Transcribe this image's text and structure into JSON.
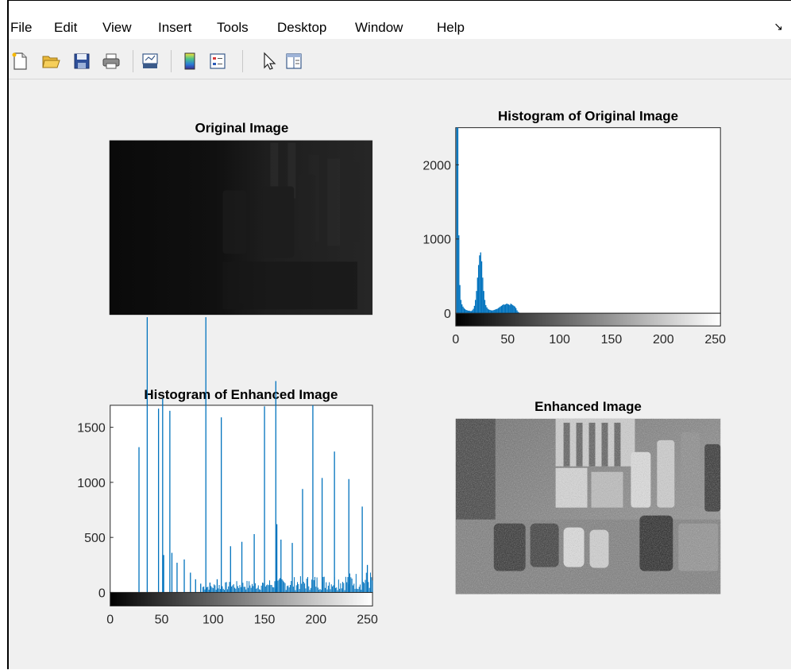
{
  "menu": {
    "items": [
      "File",
      "Edit",
      "View",
      "Insert",
      "Tools",
      "Desktop",
      "Window",
      "Help"
    ]
  },
  "toolbar": {
    "icons": [
      "new-file-icon",
      "open-folder-icon",
      "save-icon",
      "print-icon",
      "link-plot-icon",
      "colorbar-icon",
      "legend-icon",
      "pointer-icon",
      "property-inspector-icon"
    ]
  },
  "axes": {
    "original_image_title": "Original Image",
    "histogram_original_title": "Histogram of Original Image",
    "histogram_enhanced_title": "Histogram of Enhanced Image",
    "enhanced_image_title": "Enhanced Image"
  },
  "chart_data": [
    {
      "type": "bar",
      "title": "Histogram of Original Image",
      "xlim": [
        0,
        255
      ],
      "ylim": [
        0,
        2500
      ],
      "xticks": [
        0,
        50,
        100,
        150,
        200,
        250
      ],
      "yticks": [
        0,
        1000,
        2000
      ],
      "bars": [
        [
          1,
          2500
        ],
        [
          2,
          2500
        ],
        [
          3,
          1050
        ],
        [
          4,
          380
        ],
        [
          5,
          180
        ],
        [
          6,
          120
        ],
        [
          7,
          90
        ],
        [
          8,
          70
        ],
        [
          9,
          55
        ],
        [
          10,
          45
        ],
        [
          11,
          40
        ],
        [
          12,
          35
        ],
        [
          13,
          35
        ],
        [
          14,
          30
        ],
        [
          15,
          30
        ],
        [
          16,
          40
        ],
        [
          17,
          60
        ],
        [
          18,
          100
        ],
        [
          19,
          180
        ],
        [
          20,
          300
        ],
        [
          21,
          480
        ],
        [
          22,
          650
        ],
        [
          23,
          780
        ],
        [
          24,
          820
        ],
        [
          25,
          700
        ],
        [
          26,
          480
        ],
        [
          27,
          300
        ],
        [
          28,
          180
        ],
        [
          29,
          110
        ],
        [
          30,
          80
        ],
        [
          31,
          60
        ],
        [
          32,
          50
        ],
        [
          33,
          45
        ],
        [
          34,
          40
        ],
        [
          35,
          38
        ],
        [
          36,
          40
        ],
        [
          37,
          45
        ],
        [
          38,
          50
        ],
        [
          39,
          55
        ],
        [
          40,
          60
        ],
        [
          41,
          70
        ],
        [
          42,
          80
        ],
        [
          43,
          90
        ],
        [
          44,
          100
        ],
        [
          45,
          110
        ],
        [
          46,
          120
        ],
        [
          47,
          115
        ],
        [
          48,
          120
        ],
        [
          49,
          130
        ],
        [
          50,
          125
        ],
        [
          51,
          120
        ],
        [
          52,
          110
        ],
        [
          53,
          130
        ],
        [
          54,
          120
        ],
        [
          55,
          110
        ],
        [
          56,
          100
        ],
        [
          57,
          90
        ],
        [
          58,
          70
        ],
        [
          59,
          40
        ],
        [
          60,
          20
        ],
        [
          61,
          10
        ]
      ],
      "colorbar": "gray 0-255"
    },
    {
      "type": "bar",
      "title": "Histogram of Enhanced Image",
      "xlim": [
        0,
        255
      ],
      "ylim": [
        0,
        1700
      ],
      "xticks": [
        0,
        50,
        100,
        150,
        200,
        250
      ],
      "yticks": [
        0,
        500,
        1000,
        1500
      ],
      "bars": [
        [
          28,
          1320
        ],
        [
          36,
          2500
        ],
        [
          47,
          1670
        ],
        [
          51,
          1760
        ],
        [
          58,
          1650
        ],
        [
          52,
          340
        ],
        [
          60,
          360
        ],
        [
          65,
          270
        ],
        [
          72,
          300
        ],
        [
          78,
          180
        ],
        [
          83,
          120
        ],
        [
          88,
          80
        ],
        [
          93,
          2500
        ],
        [
          97,
          90
        ],
        [
          104,
          120
        ],
        [
          108,
          1590
        ],
        [
          117,
          420
        ],
        [
          128,
          460
        ],
        [
          140,
          530
        ],
        [
          150,
          1690
        ],
        [
          161,
          1920
        ],
        [
          162,
          620
        ],
        [
          166,
          480
        ],
        [
          177,
          450
        ],
        [
          187,
          940
        ],
        [
          197,
          1700
        ],
        [
          206,
          1040
        ],
        [
          218,
          1280
        ],
        [
          232,
          1030
        ],
        [
          245,
          780
        ],
        [
          250,
          250
        ]
      ],
      "noise_range": [
        90,
        255
      ],
      "colorbar": "gray 0-255"
    }
  ],
  "colors": {
    "bar": "#0072bd",
    "axes_bg": "#ffffff",
    "figure_bg": "#f0f0f0"
  }
}
